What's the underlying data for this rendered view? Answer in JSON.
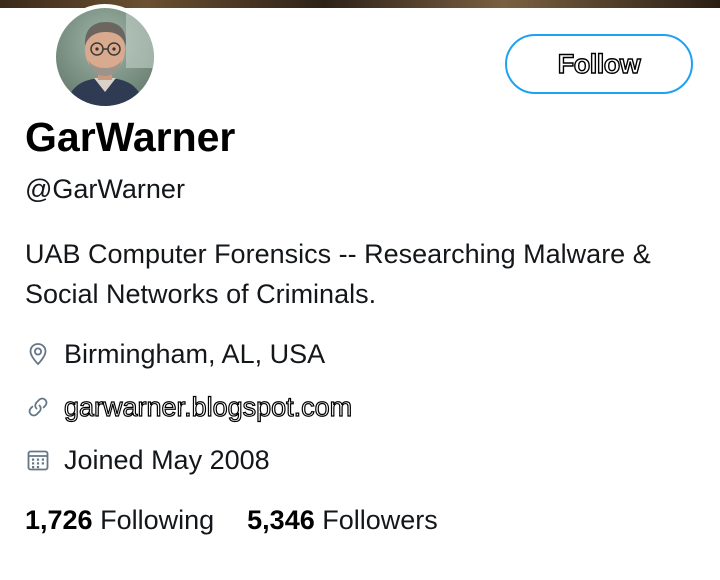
{
  "profile": {
    "display_name": "GarWarner",
    "handle": "@GarWarner",
    "bio": "UAB Computer Forensics -- Researching Malware & Social Networks of Criminals.",
    "location": "Birmingham, AL, USA",
    "website": "garwarner.blogspot.com",
    "joined": "Joined May 2008",
    "icons": {
      "location": "location-pin-icon",
      "website": "link-icon",
      "joined": "calendar-icon"
    }
  },
  "actions": {
    "follow_label": "Follow"
  },
  "stats": {
    "following_count": "1,726",
    "following_label": "Following",
    "followers_count": "5,346",
    "followers_label": "Followers"
  },
  "colors": {
    "accent": "#1da1f2",
    "text": "#14171a",
    "secondary": "#657786"
  }
}
